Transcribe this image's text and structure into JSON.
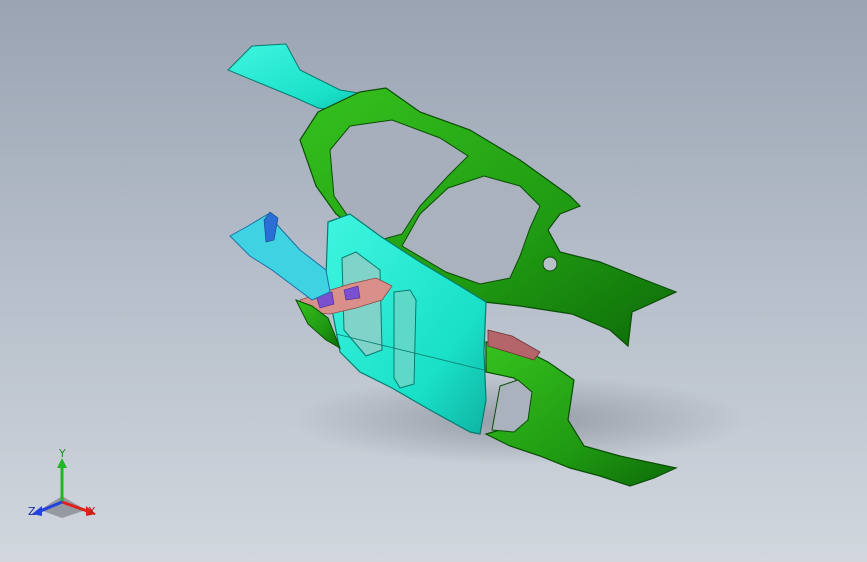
{
  "viewport": {
    "model_name": "",
    "background_top": "#9aa4b2",
    "background_bottom": "#d2d7de"
  },
  "colors": {
    "body_green": "#1f9a12",
    "body_green_dark": "#0b5e06",
    "panel_cyan": "#19e6cf",
    "panel_cyan_dark": "#0aa596",
    "inner_parts_pink": "#d9908a",
    "inner_parts_purple": "#7a4fd0",
    "accent_blue": "#2a6fd6"
  },
  "triad": {
    "x_label": "X",
    "y_label": "Y",
    "z_label": "Z",
    "x_color": "#e0201b",
    "y_color": "#21b623",
    "z_color": "#2242e0"
  }
}
